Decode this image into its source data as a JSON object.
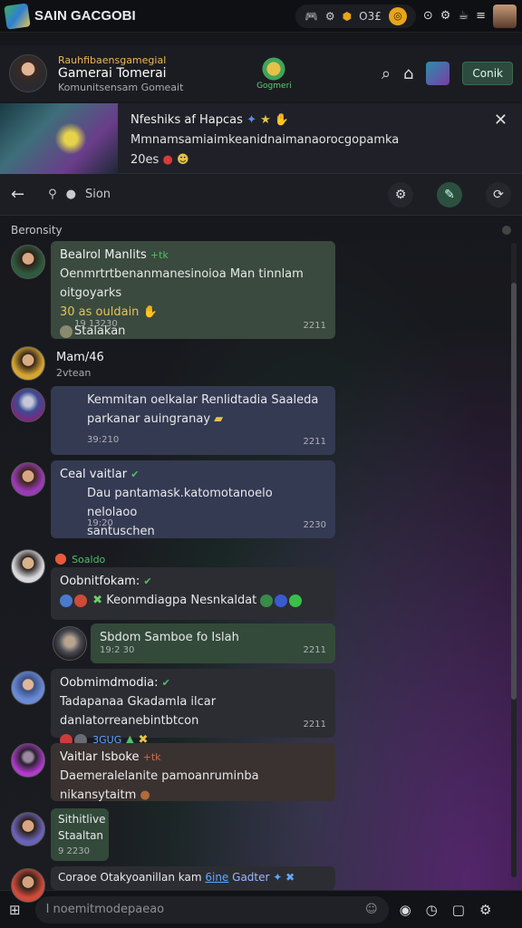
{
  "topbar": {
    "title": "SAIN GACGOBI",
    "pill_text": "O3£"
  },
  "header": {
    "sub1": "Rauhfibaensgamegial",
    "name": "Gamerai Tomerai",
    "sub2": "Komunitsensam Gomeait",
    "badge_label": "Gogmeri",
    "button": "Conik"
  },
  "banner": {
    "title": "Nfeshiks af Hapcas",
    "body": "Mmnamsamiaimkeanidnaimanaorocgopamka",
    "meta": "20es"
  },
  "toolbar": {
    "search_text": "Sion"
  },
  "section": {
    "label": "Beronsity"
  },
  "messages": [
    {
      "name": "Bealrol Manlits",
      "tag": "+tk",
      "line1": "Oenmrtrtbenanmanesinoioa Man tinnlam oitgoyarks",
      "line2": "30 as ouldain",
      "line3": "Stalakan",
      "time": "19 13230",
      "time_r": "2211"
    },
    {
      "name": "Mam/46",
      "sub": "2vtean"
    },
    {
      "line1": "Kemmitan oelkalar Renlidtadia Saaleda",
      "line2": "parkanar auingranay",
      "time": "39:210",
      "time_r": "2211"
    },
    {
      "name": "Ceal vaitlar",
      "line1": "Dau pantamask.katomotanoelo nelolaoo",
      "line2": "santuschen",
      "time": "19:20",
      "time_r": "2230"
    },
    {
      "tag": "Soaldo"
    },
    {
      "name": "Oobnitfokam:",
      "line1": "Keonmdiagpa Nesnkaldat"
    },
    {
      "line1": "Sbdom Samboe fo Islah",
      "time": "19:2 30",
      "time_r": "2211"
    },
    {
      "name": "Oobmimdmodia:",
      "line1": "Tadapanaa Gkadamla ilcar danlatorreanebintbtcon",
      "line2": "3GUG",
      "time_r": "2211"
    },
    {
      "name": "Vaitlar Isboke",
      "tag": "+tk",
      "line1": "Daemeralelanite pamoanruminba nikansytaitm"
    },
    {
      "line1": "Sithitlive",
      "line2": "Staaltan",
      "time": "9 2230"
    },
    {
      "line1": "Coraoe Otakyoanillan kam",
      "link": "6ine",
      "line1b": "Gadter"
    }
  ],
  "composer": {
    "placeholder": "I noemitmodepaeao"
  }
}
